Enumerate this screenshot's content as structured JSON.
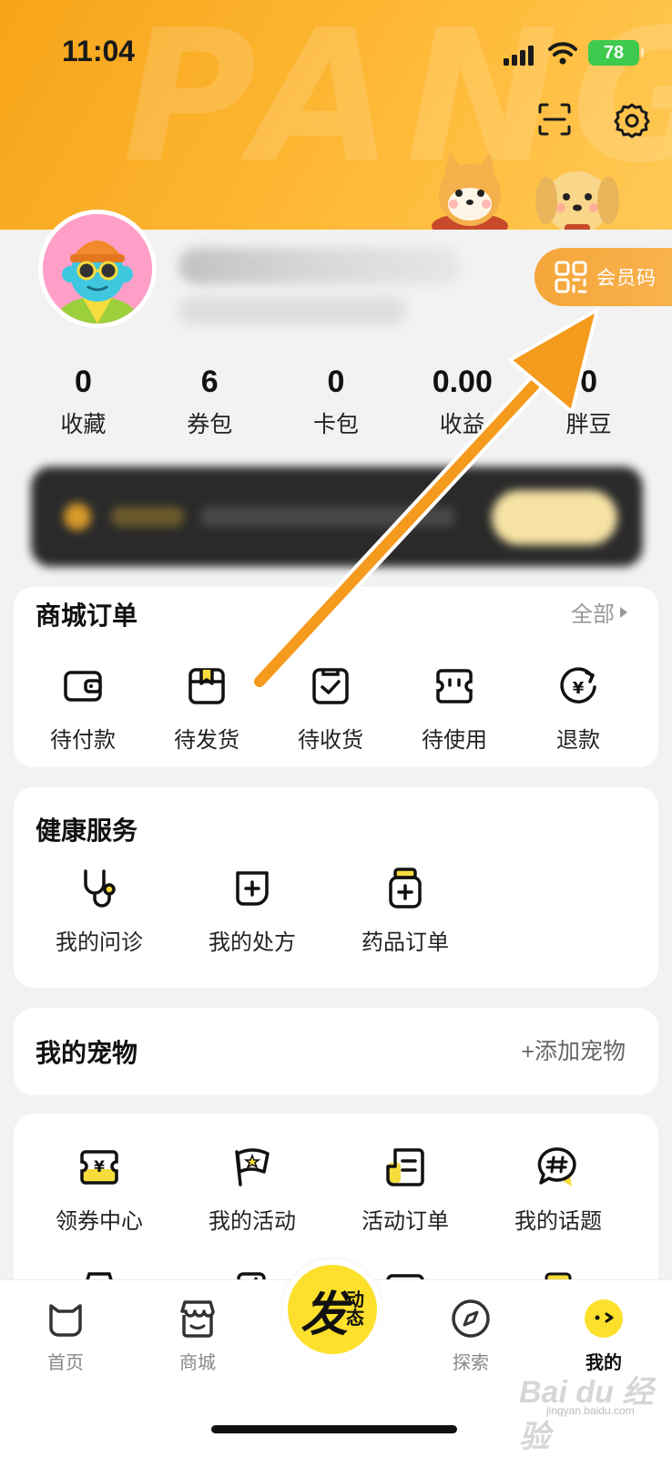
{
  "status_bar": {
    "time": "11:04",
    "battery": "78"
  },
  "header": {
    "bg_word": "PANG"
  },
  "profile": {
    "member_code_label": "会员码"
  },
  "stats": [
    {
      "value": "0",
      "label": "收藏"
    },
    {
      "value": "6",
      "label": "券包"
    },
    {
      "value": "0",
      "label": "卡包"
    },
    {
      "value": "0.00",
      "label": "收益"
    },
    {
      "value": "0",
      "label": "胖豆"
    }
  ],
  "orders": {
    "title": "商城订单",
    "all_label": "全部",
    "items": [
      {
        "label": "待付款",
        "icon": "wallet-icon"
      },
      {
        "label": "待发货",
        "icon": "package-icon"
      },
      {
        "label": "待收货",
        "icon": "receive-icon"
      },
      {
        "label": "待使用",
        "icon": "ticket-icon"
      },
      {
        "label": "退款",
        "icon": "refund-icon"
      }
    ]
  },
  "health": {
    "title": "健康服务",
    "items": [
      {
        "label": "我的问诊",
        "icon": "stethoscope-icon"
      },
      {
        "label": "我的处方",
        "icon": "prescription-icon"
      },
      {
        "label": "药品订单",
        "icon": "medicine-bottle-icon"
      }
    ]
  },
  "pets": {
    "title": "我的宠物",
    "add_label": "+添加宠物"
  },
  "tools": {
    "items": [
      {
        "label": "领券中心",
        "icon": "coupon-icon"
      },
      {
        "label": "我的活动",
        "icon": "flag-icon"
      },
      {
        "label": "活动订单",
        "icon": "activity-order-icon"
      },
      {
        "label": "我的话题",
        "icon": "topic-icon"
      }
    ]
  },
  "tabbar": {
    "home": "首页",
    "mall": "商城",
    "post_big": "发",
    "post_small_1": "动",
    "post_small_2": "态",
    "explore": "探索",
    "mine": "我的"
  },
  "colors": {
    "accent_yellow": "#fde02c",
    "header_orange": "#f7a418",
    "arrow_orange": "#f49a1c"
  },
  "watermark": {
    "brand": "Bai du 经验",
    "url": "jingyan.baidu.com"
  }
}
